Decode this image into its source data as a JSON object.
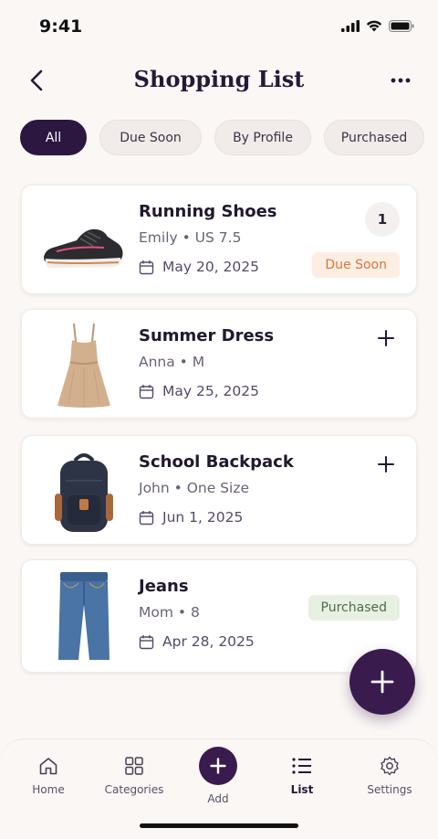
{
  "status_bar": {
    "time": "9:41"
  },
  "header": {
    "title": "Shopping List"
  },
  "filters": [
    {
      "label": "All",
      "active": true
    },
    {
      "label": "Due Soon",
      "active": false
    },
    {
      "label": "By Profile",
      "active": false
    },
    {
      "label": "Purchased",
      "active": false
    }
  ],
  "items": [
    {
      "name": "Running Shoes",
      "profile": "Emily • US 7.5",
      "date": "May 20, 2025",
      "quantity": "1",
      "status": "Due Soon",
      "icon": "running-shoe-image"
    },
    {
      "name": "Summer Dress",
      "profile": "Anna • M",
      "date": "May 25, 2025",
      "icon": "summer-dress-image"
    },
    {
      "name": "School Backpack",
      "profile": "John • One Size",
      "date": "Jun 1, 2025",
      "icon": "backpack-image"
    },
    {
      "name": "Jeans",
      "profile": "Mom • 8",
      "date": "Apr 28, 2025",
      "status": "Purchased",
      "icon": "jeans-image"
    }
  ],
  "nav": [
    {
      "label": "Home",
      "icon": "home-icon"
    },
    {
      "label": "Categories",
      "icon": "grid-icon"
    },
    {
      "label": "Add",
      "icon": "plus-icon"
    },
    {
      "label": "List",
      "icon": "list-icon",
      "active": true
    },
    {
      "label": "Settings",
      "icon": "gear-icon"
    }
  ],
  "colors": {
    "accent": "#3a1b4e",
    "due_soon": "#d5773f",
    "purchased": "#4f6d40",
    "background": "#faf7f5"
  }
}
